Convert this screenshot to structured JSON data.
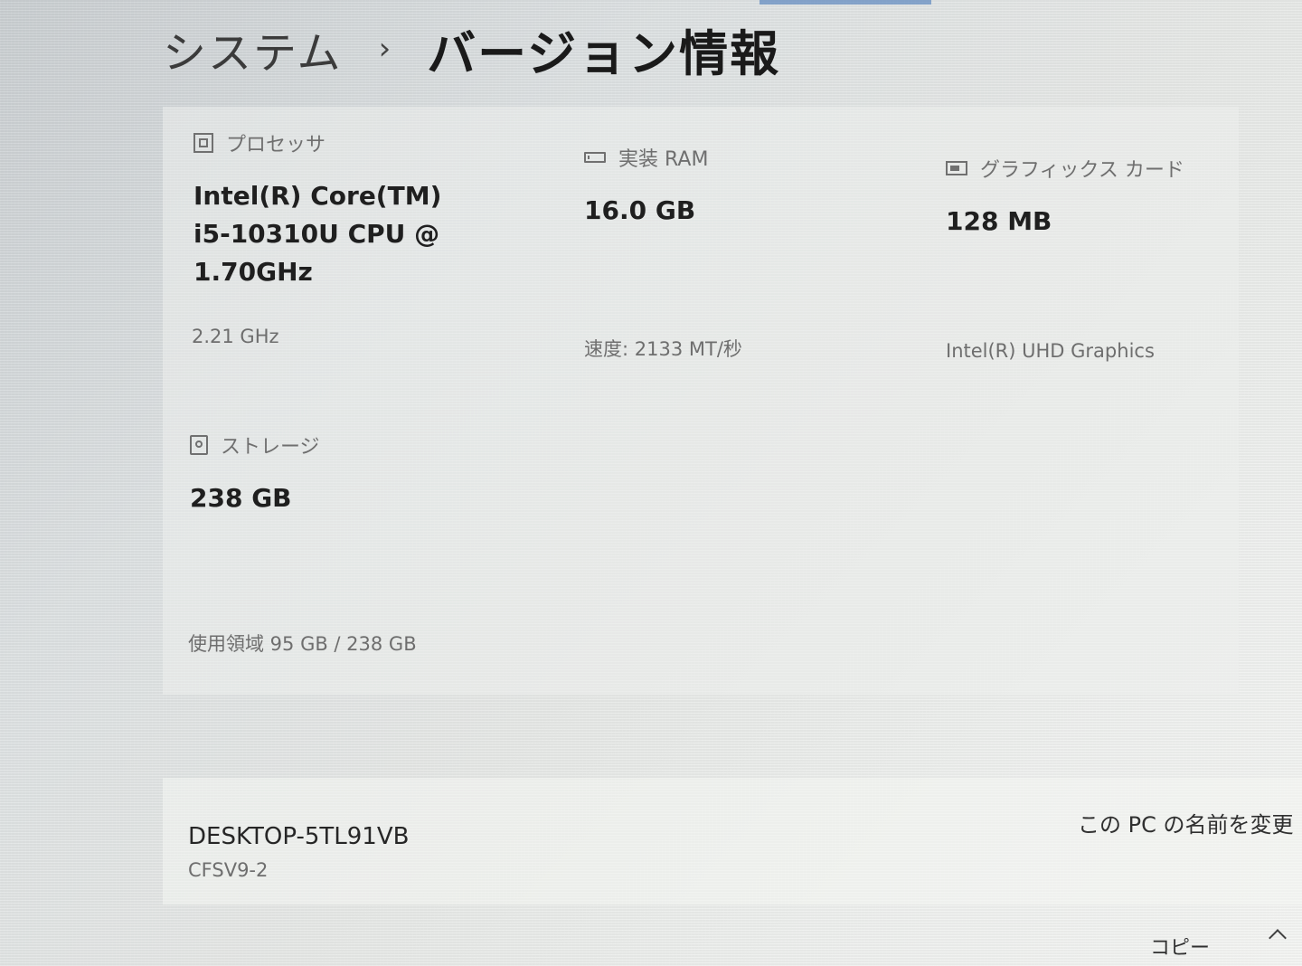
{
  "breadcrumb": {
    "parent": "システム",
    "separator": "›",
    "current": "バージョン情報"
  },
  "specs": {
    "processor": {
      "label": "プロセッサ",
      "icon": "chip-icon",
      "value_line1": "Intel(R) Core(TM)",
      "value_line2": "i5-10310U CPU @",
      "value_line3": "1.70GHz",
      "detail": "2.21 GHz"
    },
    "ram": {
      "label": "実装 RAM",
      "icon": "ram-icon",
      "value": "16.0 GB",
      "detail": "速度: 2133 MT/秒"
    },
    "graphics": {
      "label": "グラフィックス カード",
      "icon": "gpu-icon",
      "value": "128 MB",
      "detail": "Intel(R) UHD Graphics"
    },
    "storage": {
      "label": "ストレージ",
      "icon": "disk-icon",
      "value": "238 GB",
      "detail": "使用領域 95 GB / 238 GB"
    }
  },
  "device": {
    "name": "DESKTOP-5TL91VB",
    "model": "CFSV9-2",
    "rename_label": "この PC の名前を変更"
  },
  "footer": {
    "copy_label": "コピー",
    "collapse_icon": "chevron-up-icon"
  },
  "colors": {
    "accent": "#3b6fb6"
  }
}
